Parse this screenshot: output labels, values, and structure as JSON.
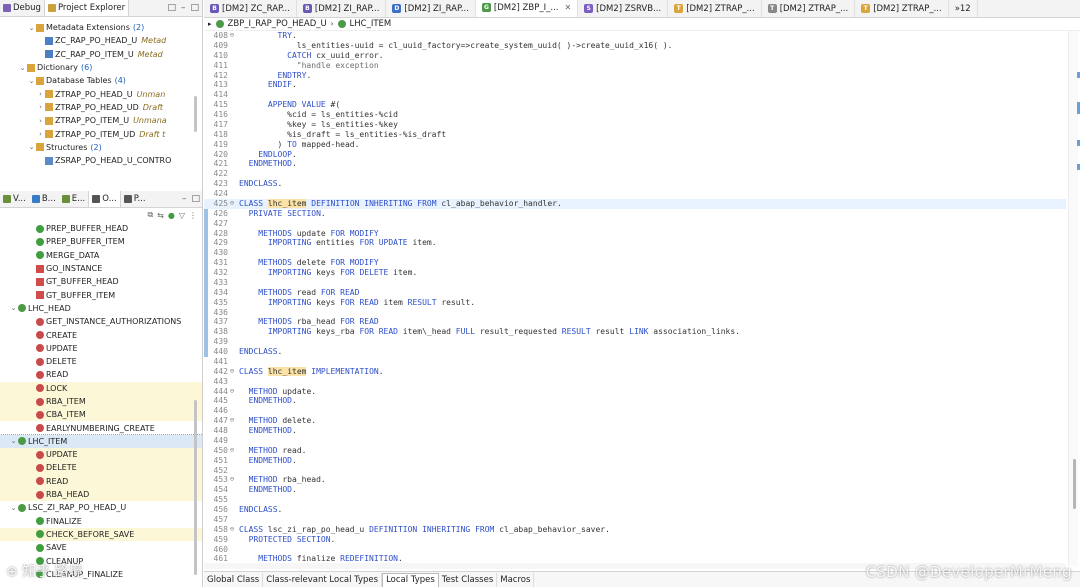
{
  "project_panel": {
    "tabs": [
      {
        "label": "Debug",
        "icon": "debug-icon",
        "color": "#7b62b8",
        "active": false
      },
      {
        "label": "Project Explorer",
        "icon": "project-explorer-icon",
        "color": "#caa23b",
        "active": true
      }
    ],
    "window_buttons": [
      "□",
      "–",
      "□"
    ],
    "tree": [
      {
        "indent": 3,
        "twisty": "⌄",
        "icon": "folder-icon",
        "color": "#d9a43b",
        "label": "Metadata Extensions",
        "count": "(2)"
      },
      {
        "indent": 4,
        "twisty": "",
        "icon": "ddlx-icon",
        "color": "#4d7fc4",
        "label": "ZC_RAP_PO_HEAD_U",
        "meta": "Metad"
      },
      {
        "indent": 4,
        "twisty": "",
        "icon": "ddlx-icon",
        "color": "#4d7fc4",
        "label": "ZC_RAP_PO_ITEM_U",
        "meta": "Metad"
      },
      {
        "indent": 2,
        "twisty": "⌄",
        "icon": "folder-icon",
        "color": "#d9a43b",
        "label": "Dictionary",
        "count": "(6)"
      },
      {
        "indent": 3,
        "twisty": "⌄",
        "icon": "folder-icon",
        "color": "#d9a43b",
        "label": "Database Tables",
        "count": "(4)"
      },
      {
        "indent": 4,
        "twisty": "›",
        "icon": "table-icon",
        "color": "#d9a43b",
        "label": "ZTRAP_PO_HEAD_U",
        "meta": "Unman"
      },
      {
        "indent": 4,
        "twisty": "›",
        "icon": "table-icon",
        "color": "#d9a43b",
        "label": "ZTRAP_PO_HEAD_UD",
        "meta": "Draft"
      },
      {
        "indent": 4,
        "twisty": "›",
        "icon": "table-icon",
        "color": "#d9a43b",
        "label": "ZTRAP_PO_ITEM_U",
        "meta": "Unmana"
      },
      {
        "indent": 4,
        "twisty": "›",
        "icon": "table-icon",
        "color": "#d9a43b",
        "label": "ZTRAP_PO_ITEM_UD",
        "meta": "Draft t"
      },
      {
        "indent": 3,
        "twisty": "⌄",
        "icon": "folder-icon",
        "color": "#d9a43b",
        "label": "Structures",
        "count": "(2)"
      },
      {
        "indent": 4,
        "twisty": "",
        "icon": "structure-icon",
        "color": "#5b8ac9",
        "label": "ZSRAP_PO_HEAD_U_CONTRO"
      }
    ]
  },
  "outline_panel": {
    "tabs": [
      {
        "label": "V...",
        "icon": "variables-icon",
        "color": "#6a8f3b"
      },
      {
        "label": "B...",
        "icon": "breakpoints-icon",
        "color": "#3a7bc8"
      },
      {
        "label": "E...",
        "icon": "expressions-icon",
        "color": "#6a8f3b"
      },
      {
        "label": "O...",
        "icon": "outline-icon",
        "color": "#555",
        "active": true
      },
      {
        "label": "P...",
        "icon": "properties-icon",
        "color": "#555"
      }
    ],
    "items": [
      {
        "indent": 3,
        "twisty": "",
        "icon": "method-green-icon",
        "color": "#3f9e3f",
        "label": "PREP_BUFFER_HEAD",
        "hl": false
      },
      {
        "indent": 3,
        "twisty": "",
        "icon": "method-green-icon",
        "color": "#3f9e3f",
        "label": "PREP_BUFFER_ITEM",
        "hl": false
      },
      {
        "indent": 3,
        "twisty": "",
        "icon": "method-green-icon",
        "color": "#3f9e3f",
        "label": "MERGE_DATA",
        "hl": false
      },
      {
        "indent": 3,
        "twisty": "",
        "icon": "attribute-icon",
        "color": "#d14b4b",
        "label": "GO_INSTANCE",
        "hl": false
      },
      {
        "indent": 3,
        "twisty": "",
        "icon": "attribute-icon",
        "color": "#d14b4b",
        "label": "GT_BUFFER_HEAD",
        "hl": false
      },
      {
        "indent": 3,
        "twisty": "",
        "icon": "attribute-icon",
        "color": "#d14b4b",
        "label": "GT_BUFFER_ITEM",
        "hl": false
      },
      {
        "indent": 1,
        "twisty": "⌄",
        "icon": "class-icon",
        "color": "#4c9a48",
        "label": "LHC_HEAD",
        "hl": false
      },
      {
        "indent": 3,
        "twisty": "",
        "icon": "private-method-icon",
        "color": "#c94a4a",
        "label": "GET_INSTANCE_AUTHORIZATIONS",
        "hl": false
      },
      {
        "indent": 3,
        "twisty": "",
        "icon": "private-method-icon",
        "color": "#c94a4a",
        "label": "CREATE",
        "hl": false
      },
      {
        "indent": 3,
        "twisty": "",
        "icon": "private-method-icon",
        "color": "#c94a4a",
        "label": "UPDATE",
        "hl": false
      },
      {
        "indent": 3,
        "twisty": "",
        "icon": "private-method-icon",
        "color": "#c94a4a",
        "label": "DELETE",
        "hl": false
      },
      {
        "indent": 3,
        "twisty": "",
        "icon": "private-method-icon",
        "color": "#c94a4a",
        "label": "READ",
        "hl": false
      },
      {
        "indent": 3,
        "twisty": "",
        "icon": "private-method-icon",
        "color": "#c94a4a",
        "label": "LOCK",
        "hl": true
      },
      {
        "indent": 3,
        "twisty": "",
        "icon": "private-method-icon",
        "color": "#c94a4a",
        "label": "RBA_ITEM",
        "hl": true
      },
      {
        "indent": 3,
        "twisty": "",
        "icon": "private-method-icon",
        "color": "#c94a4a",
        "label": "CBA_ITEM",
        "hl": true
      },
      {
        "indent": 3,
        "twisty": "",
        "icon": "private-method-icon",
        "color": "#c94a4a",
        "label": "EARLYNUMBERING_CREATE",
        "hl": false
      },
      {
        "indent": 1,
        "twisty": "⌄",
        "icon": "class-icon",
        "color": "#4c9a48",
        "label": "LHC_ITEM",
        "hl": false,
        "sel": true
      },
      {
        "indent": 3,
        "twisty": "",
        "icon": "private-method-icon",
        "color": "#c94a4a",
        "label": "UPDATE",
        "hl": true
      },
      {
        "indent": 3,
        "twisty": "",
        "icon": "private-method-icon",
        "color": "#c94a4a",
        "label": "DELETE",
        "hl": true
      },
      {
        "indent": 3,
        "twisty": "",
        "icon": "private-method-icon",
        "color": "#c94a4a",
        "label": "READ",
        "hl": true
      },
      {
        "indent": 3,
        "twisty": "",
        "icon": "private-method-icon",
        "color": "#c94a4a",
        "label": "RBA_HEAD",
        "hl": true
      },
      {
        "indent": 1,
        "twisty": "⌄",
        "icon": "class-icon",
        "color": "#4c9a48",
        "label": "LSC_ZI_RAP_PO_HEAD_U",
        "hl": false
      },
      {
        "indent": 3,
        "twisty": "",
        "icon": "method-green-icon",
        "color": "#3f9e3f",
        "label": "FINALIZE",
        "hl": false
      },
      {
        "indent": 3,
        "twisty": "",
        "icon": "method-green-icon",
        "color": "#3f9e3f",
        "label": "CHECK_BEFORE_SAVE",
        "hl": true
      },
      {
        "indent": 3,
        "twisty": "",
        "icon": "method-green-icon",
        "color": "#3f9e3f",
        "label": "SAVE",
        "hl": false
      },
      {
        "indent": 3,
        "twisty": "",
        "icon": "method-green-icon",
        "color": "#3f9e3f",
        "label": "CLEANUP",
        "hl": false
      },
      {
        "indent": 3,
        "twisty": "",
        "icon": "method-green-icon",
        "color": "#3f9e3f",
        "label": "CLEANUP_FINALIZE",
        "hl": false
      }
    ]
  },
  "editor_tabs": [
    {
      "label": "[DM2] ZC_RAP...",
      "icon": "B",
      "color": "#6a58b4"
    },
    {
      "label": "[DM2] ZI_RAP...",
      "icon": "B",
      "color": "#6a58b4"
    },
    {
      "label": "[DM2] ZI_RAP...",
      "icon": "D",
      "color": "#3d6fc4"
    },
    {
      "label": "[DM2] ZBP_I_...",
      "icon": "G",
      "color": "#4c9a48",
      "active": true,
      "close": "✕"
    },
    {
      "label": "[DM2] ZSRVB...",
      "icon": "S",
      "color": "#7b5cc4"
    },
    {
      "label": "[DM2] ZTRAP_...",
      "icon": "T",
      "color": "#d9a43b"
    },
    {
      "label": "[DM2] ZTRAP_...",
      "icon": "T",
      "color": "#888"
    },
    {
      "label": "[DM2] ZTRAP_...",
      "icon": "T",
      "color": "#d9a43b"
    },
    {
      "label": "»12",
      "icon": "",
      "color": ""
    }
  ],
  "breadcrumb": [
    "ZBP_I_RAP_PO_HEAD_U",
    "LHC_ITEM"
  ],
  "code_lines": [
    {
      "n": "408",
      "f": "⊖",
      "t": "        TRY."
    },
    {
      "n": "409",
      "f": "",
      "t": "            ls_entities-uuid = cl_uuid_factory=>create_system_uuid( )->create_uuid_x16( )."
    },
    {
      "n": "410",
      "f": "",
      "t": "          CATCH cx_uuid_error."
    },
    {
      "n": "411",
      "f": "",
      "t": "            \"handle exception"
    },
    {
      "n": "412",
      "f": "",
      "t": "        ENDTRY."
    },
    {
      "n": "413",
      "f": "",
      "t": "      ENDIF."
    },
    {
      "n": "414",
      "f": "",
      "t": ""
    },
    {
      "n": "415",
      "f": "",
      "t": "      APPEND VALUE #("
    },
    {
      "n": "416",
      "f": "",
      "t": "          %cid = ls_entities-%cid"
    },
    {
      "n": "417",
      "f": "",
      "t": "          %key = ls_entities-%key"
    },
    {
      "n": "418",
      "f": "",
      "t": "          %is_draft = ls_entities-%is_draft"
    },
    {
      "n": "419",
      "f": "",
      "t": "        ) TO mapped-head."
    },
    {
      "n": "420",
      "f": "",
      "t": "    ENDLOOP."
    },
    {
      "n": "421",
      "f": "",
      "t": "  ENDMETHOD."
    },
    {
      "n": "422",
      "f": "",
      "t": ""
    },
    {
      "n": "423",
      "f": "",
      "t": "ENDCLASS."
    },
    {
      "n": "424",
      "f": "",
      "t": ""
    },
    {
      "n": "425",
      "f": "⊖",
      "t": "CLASS lhc_item DEFINITION INHERITING FROM cl_abap_behavior_handler.",
      "cur": true
    },
    {
      "n": "426",
      "f": "",
      "t": "  PRIVATE SECTION."
    },
    {
      "n": "427",
      "f": "",
      "t": ""
    },
    {
      "n": "428",
      "f": "",
      "t": "    METHODS update FOR MODIFY"
    },
    {
      "n": "429",
      "f": "",
      "t": "      IMPORTING entities FOR UPDATE item."
    },
    {
      "n": "430",
      "f": "",
      "t": ""
    },
    {
      "n": "431",
      "f": "",
      "t": "    METHODS delete FOR MODIFY"
    },
    {
      "n": "432",
      "f": "",
      "t": "      IMPORTING keys FOR DELETE item."
    },
    {
      "n": "433",
      "f": "",
      "t": ""
    },
    {
      "n": "434",
      "f": "",
      "t": "    METHODS read FOR READ"
    },
    {
      "n": "435",
      "f": "",
      "t": "      IMPORTING keys FOR READ item RESULT result."
    },
    {
      "n": "436",
      "f": "",
      "t": ""
    },
    {
      "n": "437",
      "f": "",
      "t": "    METHODS rba_head FOR READ"
    },
    {
      "n": "438",
      "f": "",
      "t": "      IMPORTING keys_rba FOR READ item\\_head FULL result_requested RESULT result LINK association_links."
    },
    {
      "n": "439",
      "f": "",
      "t": ""
    },
    {
      "n": "440",
      "f": "",
      "t": "ENDCLASS."
    },
    {
      "n": "441",
      "f": "",
      "t": ""
    },
    {
      "n": "442",
      "f": "⊖",
      "t": "CLASS lhc_item IMPLEMENTATION."
    },
    {
      "n": "443",
      "f": "",
      "t": ""
    },
    {
      "n": "444",
      "f": "⊖",
      "t": "  METHOD update."
    },
    {
      "n": "445",
      "f": "",
      "t": "  ENDMETHOD."
    },
    {
      "n": "446",
      "f": "",
      "t": ""
    },
    {
      "n": "447",
      "f": "⊖",
      "t": "  METHOD delete."
    },
    {
      "n": "448",
      "f": "",
      "t": "  ENDMETHOD."
    },
    {
      "n": "449",
      "f": "",
      "t": ""
    },
    {
      "n": "450",
      "f": "⊖",
      "t": "  METHOD read."
    },
    {
      "n": "451",
      "f": "",
      "t": "  ENDMETHOD."
    },
    {
      "n": "452",
      "f": "",
      "t": ""
    },
    {
      "n": "453",
      "f": "⊖",
      "t": "  METHOD rba_head."
    },
    {
      "n": "454",
      "f": "",
      "t": "  ENDMETHOD."
    },
    {
      "n": "455",
      "f": "",
      "t": ""
    },
    {
      "n": "456",
      "f": "",
      "t": "ENDCLASS."
    },
    {
      "n": "457",
      "f": "",
      "t": ""
    },
    {
      "n": "458",
      "f": "⊖",
      "t": "CLASS lsc_zi_rap_po_head_u DEFINITION INHERITING FROM cl_abap_behavior_saver."
    },
    {
      "n": "459",
      "f": "",
      "t": "  PROTECTED SECTION."
    },
    {
      "n": "460",
      "f": "",
      "t": ""
    },
    {
      "n": "461",
      "f": "",
      "t": "    METHODS finalize REDEFINITION."
    }
  ],
  "bottom_tabs": [
    {
      "label": "Global Class",
      "active": false
    },
    {
      "label": "Class-relevant Local Types",
      "active": false
    },
    {
      "label": "Local Types",
      "active": true
    },
    {
      "label": "Test Classes",
      "active": false
    },
    {
      "label": "Macros",
      "active": false
    }
  ],
  "watermark": {
    "right": "CSDN @DeveloperMrMeng",
    "left": "⊕ 知乎 路境"
  }
}
